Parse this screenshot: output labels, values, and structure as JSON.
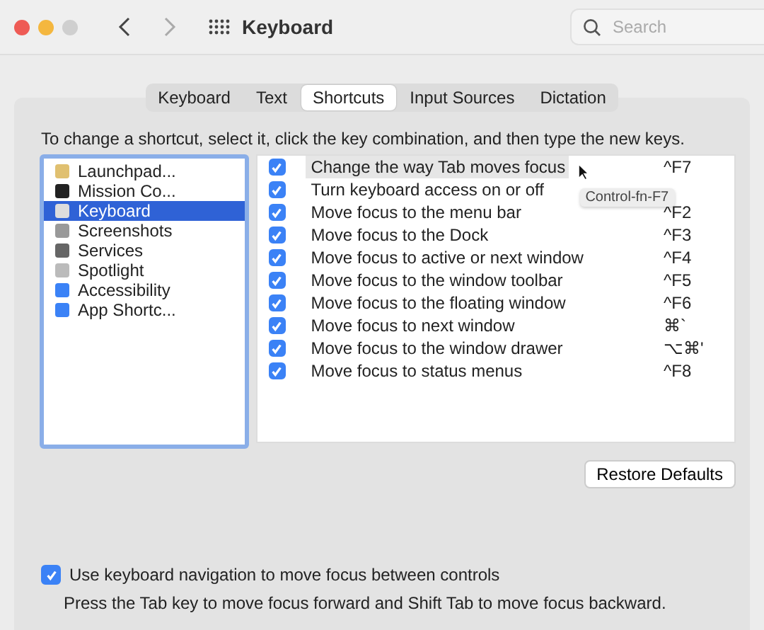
{
  "window": {
    "title": "Keyboard",
    "search": {
      "placeholder": "Search"
    }
  },
  "tabs": [
    {
      "label": "Keyboard",
      "selected": false
    },
    {
      "label": "Text",
      "selected": false
    },
    {
      "label": "Shortcuts",
      "selected": true
    },
    {
      "label": "Input Sources",
      "selected": false
    },
    {
      "label": "Dictation",
      "selected": false
    }
  ],
  "instruction": "To change a shortcut, select it, click the key combination, and then type the new keys.",
  "categories": [
    {
      "label": "Launchpad...",
      "selected": false
    },
    {
      "label": "Mission Co...",
      "selected": false
    },
    {
      "label": "Keyboard",
      "selected": true
    },
    {
      "label": "Screenshots",
      "selected": false
    },
    {
      "label": "Services",
      "selected": false
    },
    {
      "label": "Spotlight",
      "selected": false
    },
    {
      "label": "Accessibility",
      "selected": false
    },
    {
      "label": "App Shortc...",
      "selected": false
    }
  ],
  "shortcuts": [
    {
      "label": "Change the way Tab moves focus",
      "keys": "^F7",
      "checked": true,
      "selected": true
    },
    {
      "label": "Turn keyboard access on or off",
      "checked": true,
      "selected": false
    },
    {
      "label": "Move focus to the menu bar",
      "keys": "^F2",
      "checked": true,
      "selected": false
    },
    {
      "label": "Move focus to the Dock",
      "keys": "^F3",
      "checked": true,
      "selected": false
    },
    {
      "label": "Move focus to active or next window",
      "keys": "^F4",
      "checked": true,
      "selected": false
    },
    {
      "label": "Move focus to the window toolbar",
      "keys": "^F5",
      "checked": true,
      "selected": false
    },
    {
      "label": "Move focus to the floating window",
      "keys": "^F6",
      "checked": true,
      "selected": false
    },
    {
      "label": "Move focus to next window",
      "keys": "⌘`",
      "checked": true,
      "selected": false
    },
    {
      "label": "Move focus to the window drawer",
      "keys": "⌥⌘'",
      "checked": true,
      "selected": false
    },
    {
      "label": "Move focus to status menus",
      "keys": "^F8",
      "checked": true,
      "selected": false
    }
  ],
  "tooltip": "Control-fn-F7",
  "restore_button": "Restore Defaults",
  "keyboard_navigation": {
    "label": "Use keyboard navigation to move focus between controls",
    "checked": true,
    "note": "Press the Tab key to move focus forward and Shift Tab to move focus backward."
  }
}
